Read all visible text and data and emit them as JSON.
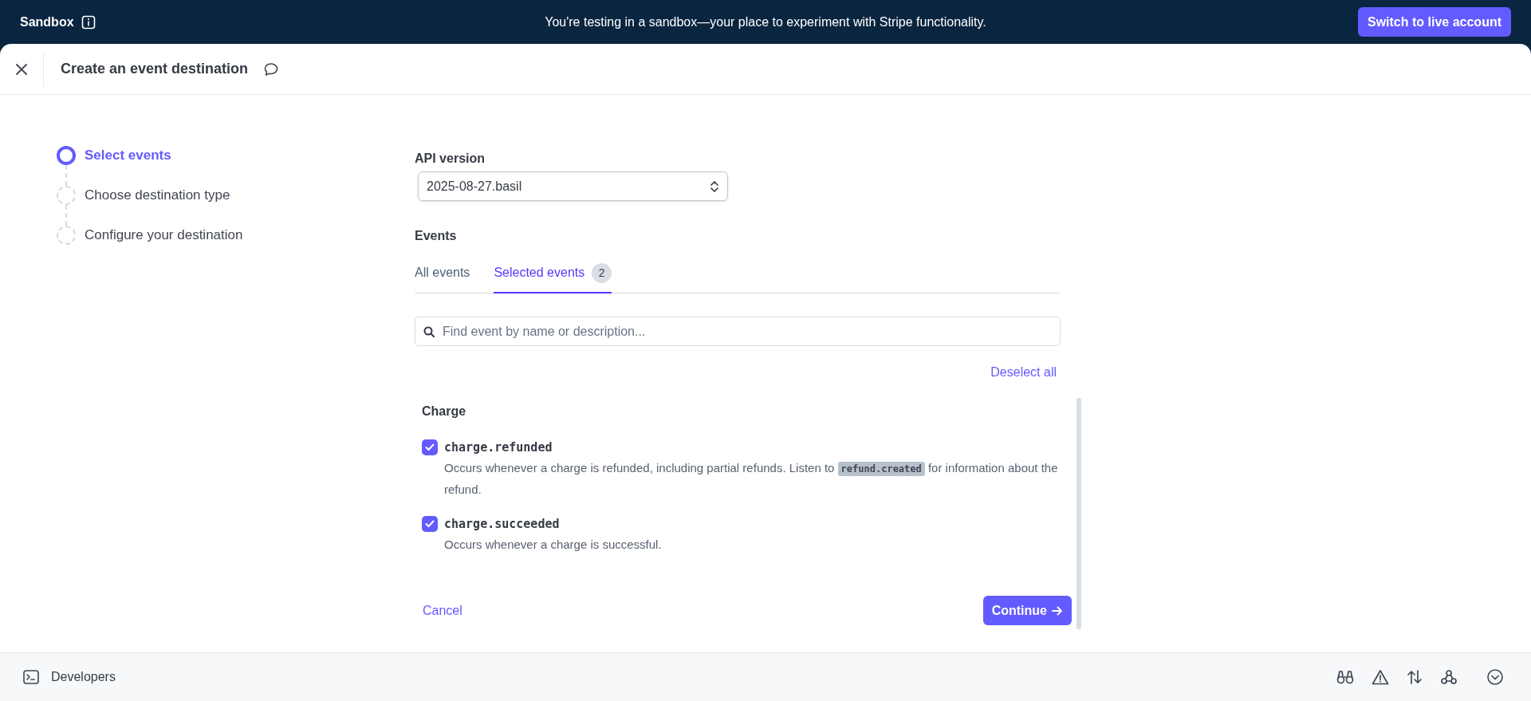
{
  "banner": {
    "mode": "Sandbox",
    "message": "You're testing in a sandbox—your place to experiment with Stripe functionality.",
    "button": "Switch to live account"
  },
  "header": {
    "title": "Create an event destination"
  },
  "steps": [
    {
      "label": "Select events",
      "selected": true
    },
    {
      "label": "Choose destination type",
      "selected": false
    },
    {
      "label": "Configure your destination",
      "selected": false
    }
  ],
  "form": {
    "api_version": {
      "label": "API version",
      "value": "2025-08-27.basil"
    },
    "events_label": "Events",
    "tabs": [
      {
        "label": "All events",
        "selected": false
      },
      {
        "label": "Selected events",
        "selected": true,
        "count": "2"
      }
    ],
    "search": {
      "placeholder": "Find event by name or description..."
    },
    "deselect_all": "Deselect all",
    "groups": [
      {
        "title": "Charge",
        "events": [
          {
            "name": "charge.refunded",
            "checked": true,
            "description": [
              {
                "kind": "text",
                "text": "Occurs whenever a charge is refunded, including partial refunds. Listen to "
              },
              {
                "kind": "code",
                "text": "refund.created"
              },
              {
                "kind": "text",
                "text": " for information about the refund."
              }
            ]
          },
          {
            "name": "charge.succeeded",
            "checked": true,
            "description": [
              {
                "kind": "text",
                "text": "Occurs whenever a charge is successful."
              }
            ]
          }
        ]
      }
    ],
    "cancel": "Cancel",
    "continue": "Continue"
  },
  "footer": {
    "label": "Developers"
  }
}
